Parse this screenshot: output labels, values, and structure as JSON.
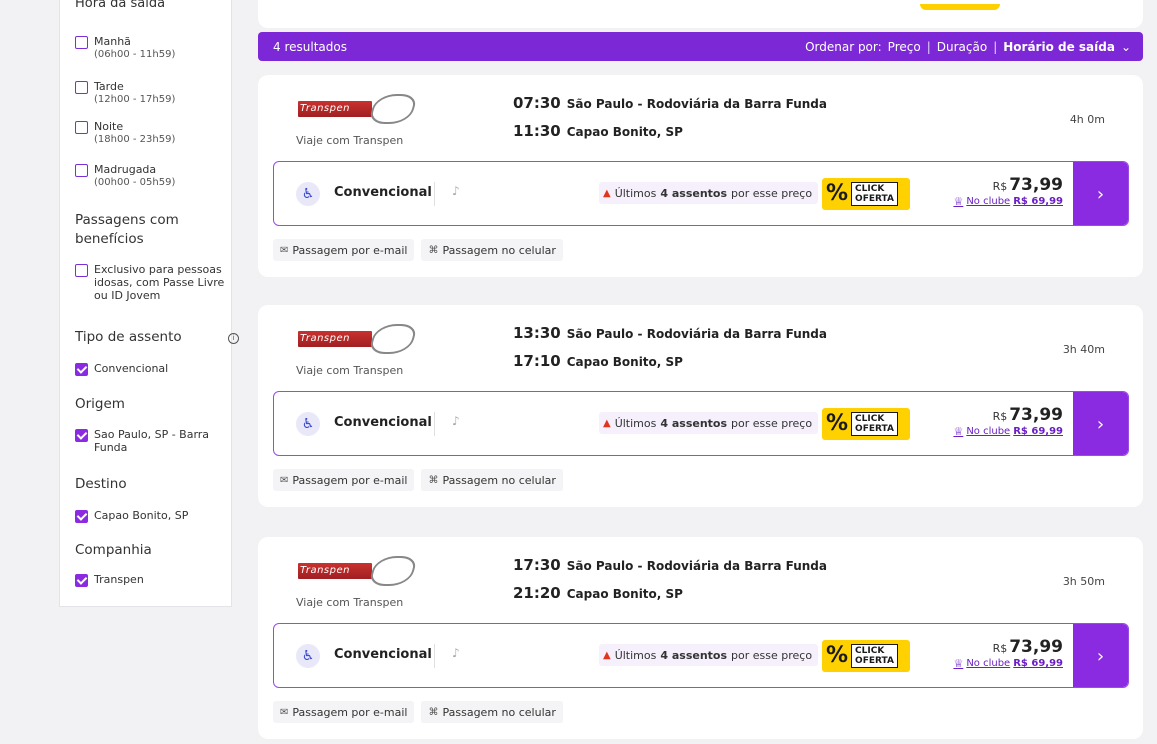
{
  "sidebar": {
    "cut_section_title": "Hora da saída",
    "departure_times": [
      {
        "label": "Manhã",
        "range": "(06h00 - 11h59)",
        "checked": false
      },
      {
        "label": "Tarde",
        "range": "(12h00 - 17h59)",
        "checked": false
      },
      {
        "label": "Noite",
        "range": "(18h00 - 23h59)",
        "checked": false
      },
      {
        "label": "Madrugada",
        "range": "(00h00 - 05h59)",
        "checked": false
      }
    ],
    "benefits_title": "Passagens com benefícios",
    "benefits_option": "Exclusivo para pessoas idosas, com Passe Livre ou ID Jovem",
    "seat_type_title": "Tipo de assento",
    "seat_type_option": "Convencional",
    "origin_title": "Origem",
    "origin_option": "Sao Paulo, SP - Barra Funda",
    "destination_title": "Destino",
    "destination_option": "Capao Bonito, SP",
    "company_title": "Companhia",
    "company_option": "Transpen"
  },
  "results": {
    "count_label": "4 resultados",
    "sort_label": "Ordenar por:",
    "sort_price": "Preço",
    "sort_duration": "Duração",
    "sort_departure": "Horário de saída"
  },
  "trips": [
    {
      "logo_text": "Transpen",
      "operator": "Viaje com Transpen",
      "dep_time": "07:30",
      "dep_place": "São Paulo - Rodoviária da Barra Funda",
      "arr_time": "11:30",
      "arr_place": "Capao Bonito, SP",
      "duration": "4h 0m",
      "seat_type": "Convencional",
      "last_seats_pre": "Últimos",
      "last_seats_bold": "4 assentos",
      "last_seats_post": "por esse preço",
      "badge_pct": "%",
      "badge_line1": "CLICK",
      "badge_line2": "OFERTA",
      "currency": "R$",
      "price": "73,99",
      "club_label": "No clube",
      "club_price": "R$ 69,99",
      "chip_email": "Passagem por e-mail",
      "chip_phone": "Passagem no celular"
    },
    {
      "logo_text": "Transpen",
      "operator": "Viaje com Transpen",
      "dep_time": "13:30",
      "dep_place": "São Paulo - Rodoviária da Barra Funda",
      "arr_time": "17:10",
      "arr_place": "Capao Bonito, SP",
      "duration": "3h 40m",
      "seat_type": "Convencional",
      "last_seats_pre": "Últimos",
      "last_seats_bold": "4 assentos",
      "last_seats_post": "por esse preço",
      "badge_pct": "%",
      "badge_line1": "CLICK",
      "badge_line2": "OFERTA",
      "currency": "R$",
      "price": "73,99",
      "club_label": "No clube",
      "club_price": "R$ 69,99",
      "chip_email": "Passagem por e-mail",
      "chip_phone": "Passagem no celular"
    },
    {
      "logo_text": "Transpen",
      "operator": "Viaje com Transpen",
      "dep_time": "17:30",
      "dep_place": "São Paulo - Rodoviária da Barra Funda",
      "arr_time": "21:20",
      "arr_place": "Capao Bonito, SP",
      "duration": "3h 50m",
      "seat_type": "Convencional",
      "last_seats_pre": "Últimos",
      "last_seats_bold": "4 assentos",
      "last_seats_post": "por esse preço",
      "badge_pct": "%",
      "badge_line1": "CLICK",
      "badge_line2": "OFERTA",
      "currency": "R$",
      "price": "73,99",
      "club_label": "No clube",
      "club_price": "R$ 69,99",
      "chip_email": "Passagem por e-mail",
      "chip_phone": "Passagem no celular"
    }
  ],
  "icons": {
    "seat": "seat-icon",
    "amenity": "armchair-icon",
    "fire": "fire-icon",
    "crown": "crown-icon",
    "arrow": "chevron-right-icon",
    "email": "email-icon",
    "phone": "qr-icon",
    "info": "info-icon",
    "sort_chevron": "chevron-down-icon"
  },
  "colors": {
    "brand_purple": "#7d28d6",
    "button_purple": "#8a2be2",
    "badge_yellow": "#ffd100",
    "logo_red": "#c9322f"
  }
}
